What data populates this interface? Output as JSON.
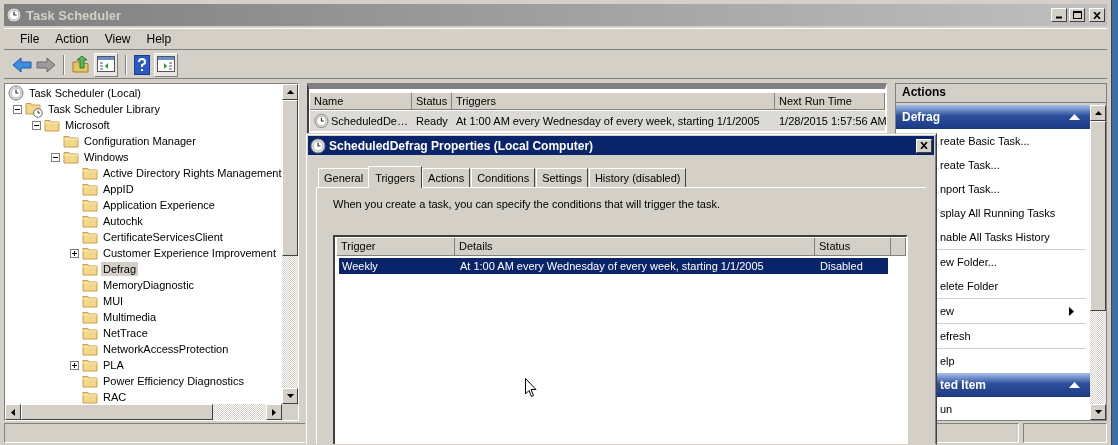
{
  "window": {
    "title": "Task Scheduler"
  },
  "menu": [
    "File",
    "Action",
    "View",
    "Help"
  ],
  "tree": [
    {
      "label": "Task Scheduler (Local)",
      "kind": "root",
      "selected": false,
      "children": [
        {
          "label": "Task Scheduler Library",
          "kind": "library",
          "expanded": true,
          "selected": false,
          "children": [
            {
              "label": "Microsoft",
              "kind": "folder",
              "expanded": true,
              "selected": false,
              "children": [
                {
                  "label": "Configuration Manager",
                  "kind": "folder",
                  "selected": false
                },
                {
                  "label": "Windows",
                  "kind": "folder",
                  "expanded": true,
                  "selected": false,
                  "children": [
                    {
                      "label": "Active Directory Rights Management",
                      "kind": "folder",
                      "selected": false
                    },
                    {
                      "label": "AppID",
                      "kind": "folder",
                      "selected": false
                    },
                    {
                      "label": "Application Experience",
                      "kind": "folder",
                      "selected": false
                    },
                    {
                      "label": "Autochk",
                      "kind": "folder",
                      "selected": false
                    },
                    {
                      "label": "CertificateServicesClient",
                      "kind": "folder",
                      "selected": false
                    },
                    {
                      "label": "Customer Experience Improvement",
                      "kind": "folder",
                      "expanded": false,
                      "selected": false
                    },
                    {
                      "label": "Defrag",
                      "kind": "folder",
                      "selected": true
                    },
                    {
                      "label": "MemoryDiagnostic",
                      "kind": "folder",
                      "selected": false
                    },
                    {
                      "label": "MUI",
                      "kind": "folder",
                      "selected": false
                    },
                    {
                      "label": "Multimedia",
                      "kind": "folder",
                      "selected": false
                    },
                    {
                      "label": "NetTrace",
                      "kind": "folder",
                      "selected": false
                    },
                    {
                      "label": "NetworkAccessProtection",
                      "kind": "folder",
                      "selected": false
                    },
                    {
                      "label": "PLA",
                      "kind": "folder",
                      "expanded": false,
                      "selected": false
                    },
                    {
                      "label": "Power Efficiency Diagnostics",
                      "kind": "folder",
                      "selected": false
                    },
                    {
                      "label": "RAC",
                      "kind": "folder",
                      "selected": false
                    }
                  ]
                }
              ]
            }
          ]
        }
      ]
    }
  ],
  "task_list": {
    "columns": [
      "Name",
      "Status",
      "Triggers",
      "Next Run Time"
    ],
    "rows": [
      {
        "cells": [
          "ScheduledDe…",
          "Ready",
          "At 1:00 AM every Wednesday of every week, starting 1/1/2005",
          "1/28/2015 1:57:56 AM"
        ],
        "selected": true
      }
    ]
  },
  "actions_pane": {
    "title": "Actions",
    "sections": [
      {
        "title": "Defrag",
        "expanded": true,
        "groups": [
          [
            {
              "label": "reate Basic Task..."
            },
            {
              "label": "reate Task..."
            },
            {
              "label": "nport Task..."
            },
            {
              "label": "splay All Running Tasks"
            },
            {
              "label": "nable All Tasks History"
            }
          ],
          [
            {
              "label": "ew Folder..."
            },
            {
              "label": "elete Folder"
            }
          ],
          [
            {
              "label": "ew",
              "submenu": true
            }
          ],
          [
            {
              "label": "efresh"
            }
          ],
          [
            {
              "label": "elp"
            }
          ]
        ]
      },
      {
        "title": "ted Item",
        "expanded": true,
        "groups": [
          [
            {
              "label": "un"
            }
          ]
        ]
      }
    ]
  },
  "dialog": {
    "title": "ScheduledDefrag Properties (Local Computer)",
    "tabs": [
      {
        "label": "General",
        "selected": false
      },
      {
        "label": "Triggers",
        "selected": true
      },
      {
        "label": "Actions",
        "selected": false
      },
      {
        "label": "Conditions",
        "selected": false
      },
      {
        "label": "Settings",
        "selected": false
      },
      {
        "label": "History (disabled)",
        "selected": false
      }
    ],
    "description": "When you create a task, you can specify the conditions that will trigger the task.",
    "triggers": {
      "columns": [
        "Trigger",
        "Details",
        "Status"
      ],
      "rows": [
        {
          "cells": [
            "Weekly",
            "At 1:00 AM every Wednesday of every week, starting 1/1/2005",
            "Disabled"
          ],
          "selected": true
        }
      ]
    }
  }
}
